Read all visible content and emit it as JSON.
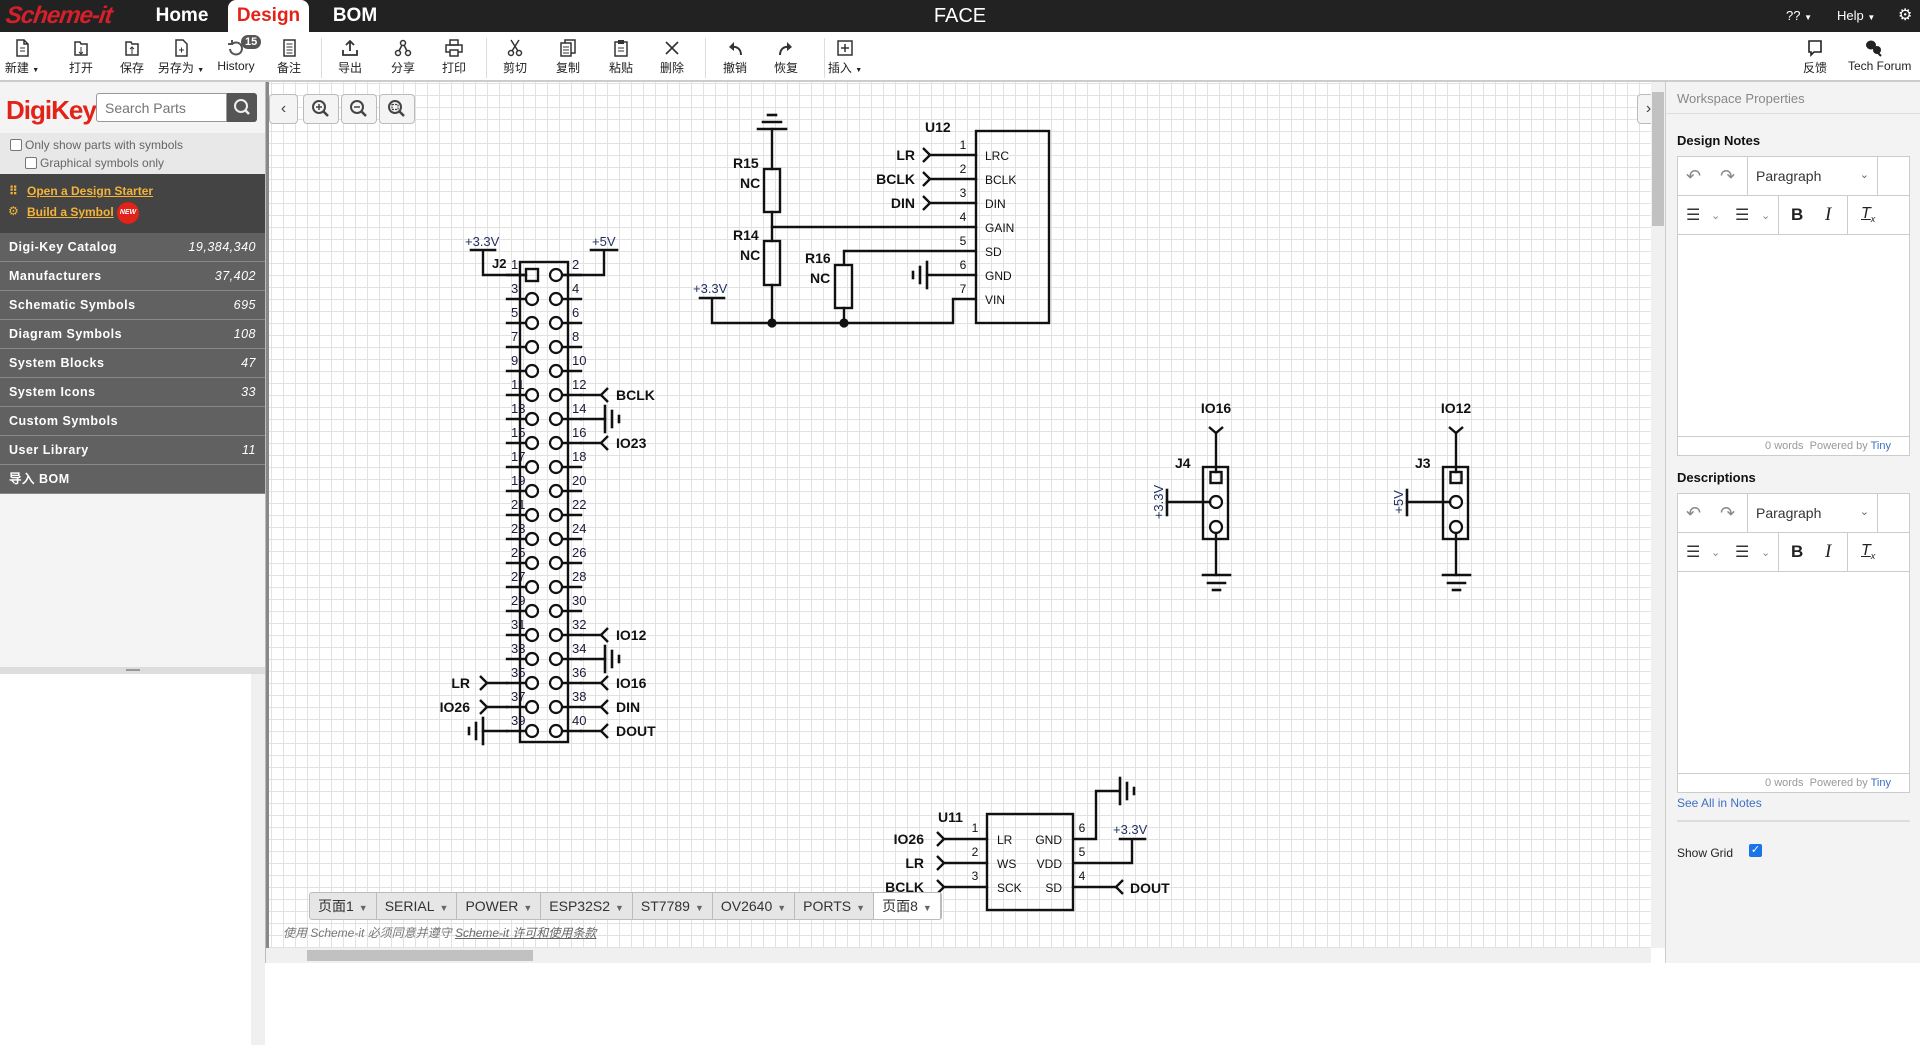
{
  "app": {
    "logo": "Scheme-it",
    "title": "FACE",
    "nav": [
      "Home",
      "Design",
      "BOM"
    ],
    "active_nav": "Design",
    "menu": [
      "??",
      "Help"
    ],
    "accent": "#e2231a"
  },
  "toolbar": {
    "items": [
      {
        "id": "new",
        "label": "新建",
        "icon": "new-document-icon",
        "dropdown": true
      },
      {
        "id": "open",
        "label": "打开",
        "icon": "open-folder-icon"
      },
      {
        "id": "save",
        "label": "保存",
        "icon": "save-icon"
      },
      {
        "id": "saveas",
        "label": "另存为",
        "icon": "save-as-icon",
        "dropdown": true
      },
      {
        "id": "history",
        "label": "History",
        "icon": "history-icon",
        "badge": "15"
      },
      {
        "id": "notes",
        "label": "备注",
        "icon": "notes-icon"
      },
      {
        "id": "export",
        "label": "导出",
        "icon": "export-icon"
      },
      {
        "id": "share",
        "label": "分享",
        "icon": "share-icon"
      },
      {
        "id": "print",
        "label": "打印",
        "icon": "print-icon"
      },
      {
        "id": "cut",
        "label": "剪切",
        "icon": "cut-icon"
      },
      {
        "id": "copy",
        "label": "复制",
        "icon": "copy-icon"
      },
      {
        "id": "paste",
        "label": "粘贴",
        "icon": "paste-icon"
      },
      {
        "id": "delete",
        "label": "删除",
        "icon": "delete-icon"
      },
      {
        "id": "undo",
        "label": "撤销",
        "icon": "undo-icon"
      },
      {
        "id": "redo",
        "label": "恢复",
        "icon": "redo-icon"
      },
      {
        "id": "insert",
        "label": "插入",
        "icon": "insert-icon",
        "dropdown": true
      }
    ],
    "right": [
      {
        "id": "feedback",
        "label": "反馈",
        "icon": "feedback-icon"
      },
      {
        "id": "forum",
        "label": "Tech Forum",
        "icon": "forum-icon"
      }
    ]
  },
  "left": {
    "brand": "DigiKey",
    "search_placeholder": "Search Parts",
    "only_symbols": "Only show parts with symbols",
    "graphical_only": "Graphical symbols only",
    "design_starter": "Open a Design Starter",
    "build_symbol": "Build a Symbol",
    "new_badge": "NEW",
    "categories": [
      {
        "label": "Digi-Key Catalog",
        "count": "19,384,340"
      },
      {
        "label": "Manufacturers",
        "count": "37,402"
      },
      {
        "label": "Schematic Symbols",
        "count": "695"
      },
      {
        "label": "Diagram Symbols",
        "count": "108"
      },
      {
        "label": "System Blocks",
        "count": "47"
      },
      {
        "label": "System Icons",
        "count": "33"
      },
      {
        "label": "Custom Symbols",
        "count": ""
      },
      {
        "label": "User Library",
        "count": "11"
      },
      {
        "label": "导入 BOM",
        "count": ""
      }
    ]
  },
  "pages": {
    "tabs": [
      "页面1",
      "SERIAL",
      "POWER",
      "ESP32S2",
      "ST7789",
      "OV2640",
      "PORTS",
      "页面8"
    ],
    "active": "页面8"
  },
  "footer": {
    "prefix": "使用 Scheme-it 必须同意并遵守 ",
    "link": "Scheme-it 许可和使用条款"
  },
  "right": {
    "header": "Workspace Properties",
    "design_notes": "Design Notes",
    "descriptions": "Descriptions",
    "block_format": "Paragraph",
    "word_count": "0 words",
    "powered_by": "Powered by",
    "tiny": "Tiny",
    "see_all": "See All in Notes",
    "show_grid": "Show Grid",
    "show_grid_checked": true
  },
  "schematic": {
    "j2": {
      "ref": "J2",
      "pins": [
        "1",
        "2",
        "3",
        "4",
        "5",
        "6",
        "7",
        "8",
        "9",
        "10",
        "11",
        "12",
        "13",
        "14",
        "15",
        "16",
        "17",
        "18",
        "19",
        "20",
        "21",
        "22",
        "23",
        "24",
        "25",
        "26",
        "27",
        "28",
        "29",
        "30",
        "31",
        "32",
        "33",
        "34",
        "35",
        "36",
        "37",
        "38",
        "39",
        "40"
      ],
      "power_left": "+3.3V",
      "power_right": "+5V",
      "right_nets": [
        {
          "pin": 12,
          "net": "BCLK"
        },
        {
          "pin": 16,
          "net": "IO23"
        },
        {
          "pin": 32,
          "net": "IO12"
        },
        {
          "pin": 36,
          "net": "IO16"
        },
        {
          "pin": 38,
          "net": "DIN"
        },
        {
          "pin": 40,
          "net": "DOUT"
        }
      ],
      "left_nets": [
        {
          "pin": 35,
          "net": "LR"
        },
        {
          "pin": 37,
          "net": "IO26"
        }
      ],
      "ground_pins": [
        14,
        34,
        39
      ]
    },
    "u12": {
      "ref": "U12",
      "power": "+3.3V",
      "pins": [
        {
          "num": "1",
          "name": "LRC",
          "net": "LR"
        },
        {
          "num": "2",
          "name": "BCLK",
          "net": "BCLK"
        },
        {
          "num": "3",
          "name": "DIN",
          "net": "DIN"
        },
        {
          "num": "4",
          "name": "GAIN"
        },
        {
          "num": "5",
          "name": "SD"
        },
        {
          "num": "6",
          "name": "GND"
        },
        {
          "num": "7",
          "name": "VIN"
        }
      ]
    },
    "resistors": [
      {
        "ref": "R15",
        "value": "NC"
      },
      {
        "ref": "R14",
        "value": "NC"
      },
      {
        "ref": "R16",
        "value": "NC"
      }
    ],
    "jumpers": [
      {
        "ref": "J4",
        "net": "IO16",
        "power": "+3.3V"
      },
      {
        "ref": "J3",
        "net": "IO12",
        "power": "+5V"
      }
    ],
    "u11": {
      "ref": "U11",
      "power": "+3.3V",
      "left": [
        {
          "num": "1",
          "name": "LR",
          "net": "IO26"
        },
        {
          "num": "2",
          "name": "WS",
          "net": "LR"
        },
        {
          "num": "3",
          "name": "SCK",
          "net": "BCLK"
        }
      ],
      "right": [
        {
          "num": "6",
          "name": "GND"
        },
        {
          "num": "5",
          "name": "VDD"
        },
        {
          "num": "4",
          "name": "SD",
          "net": "DOUT"
        }
      ]
    }
  }
}
